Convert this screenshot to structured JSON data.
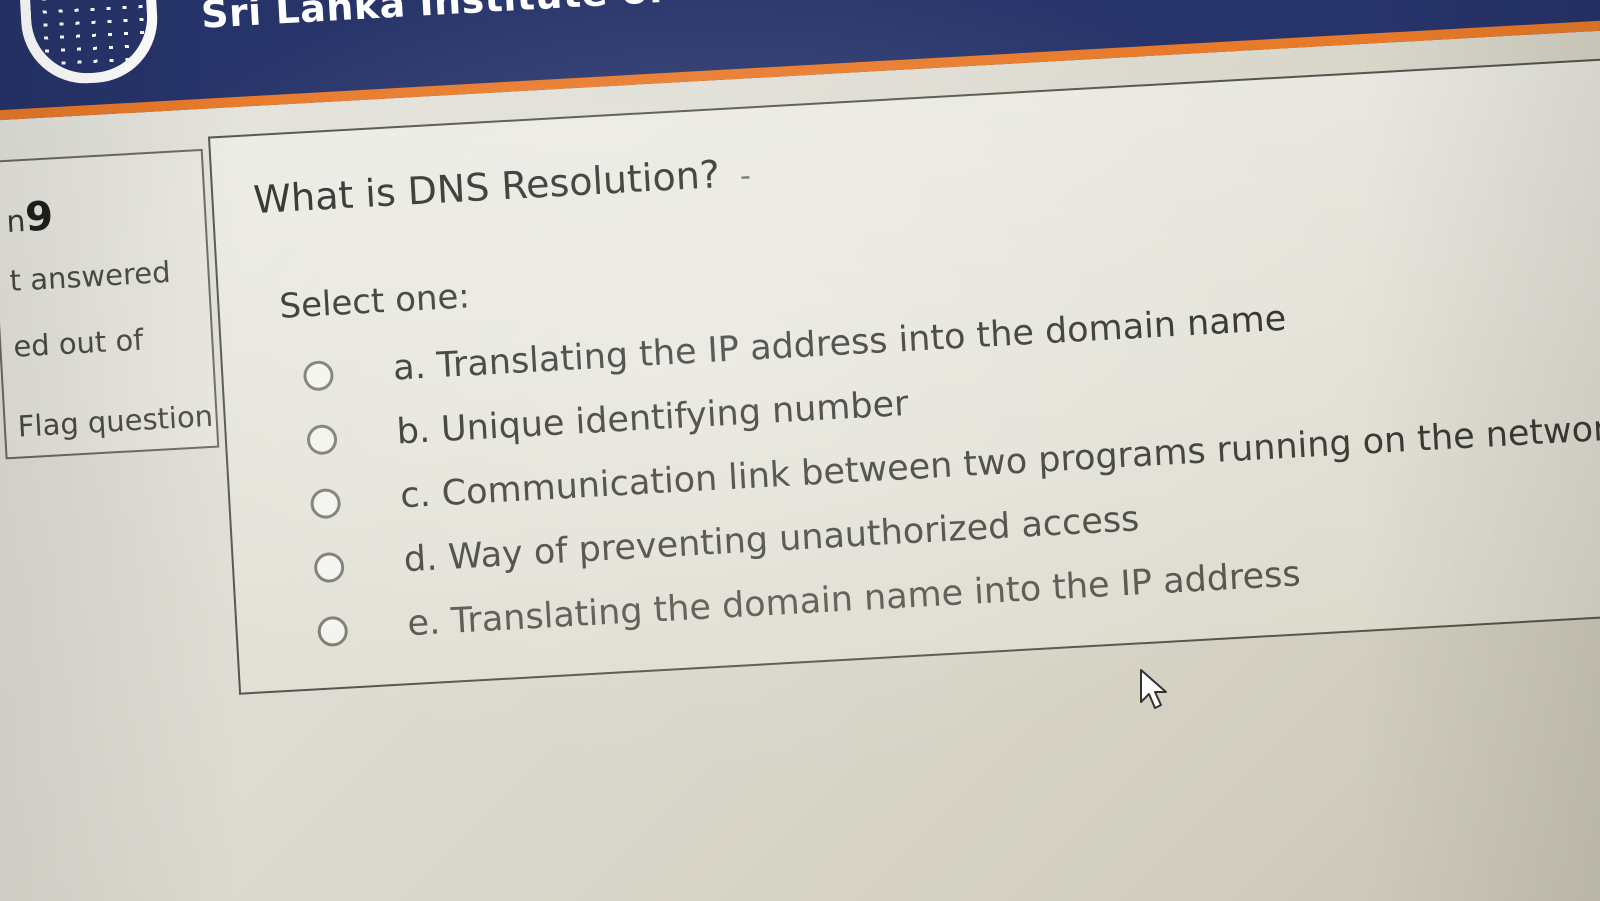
{
  "header": {
    "institute_title": "Sri Lanka Institute of",
    "logo": "university-crest-logo"
  },
  "question_info": {
    "number_prefix": "n",
    "number": "9",
    "state": "t answered",
    "mark": "ed out of",
    "flag_label": "Flag question"
  },
  "question": {
    "text": "What is DNS Resolution?",
    "suffix": "-",
    "prompt": "Select one:",
    "options": [
      {
        "label": "a. Translating the IP address into the domain name",
        "selected": false
      },
      {
        "label": "b. Unique identifying number",
        "selected": false
      },
      {
        "label": "c. Communication link between two programs running on the network",
        "selected": false
      },
      {
        "label": "d. Way of preventing unauthorized access",
        "selected": false
      },
      {
        "label": "e. Translating the domain name into the IP address",
        "selected": false
      }
    ]
  },
  "colors": {
    "header_bg": "#27346a",
    "header_accent": "#e87a2a",
    "text": "#2f2f2c"
  },
  "icons": {
    "cursor": "mouse-pointer-icon",
    "radio": "radio-button-icon"
  }
}
